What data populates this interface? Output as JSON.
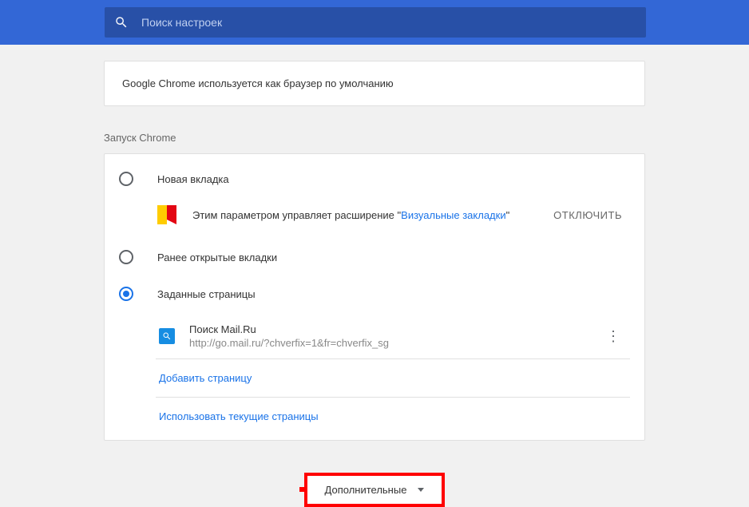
{
  "search": {
    "placeholder": "Поиск настроек"
  },
  "defaultBrowser": {
    "message": "Google Chrome используется как браузер по умолчанию"
  },
  "startup": {
    "sectionTitle": "Запуск Chrome",
    "options": {
      "newTab": "Новая вкладка",
      "continue": "Ранее открытые вкладки",
      "specific": "Заданные страницы"
    },
    "extension": {
      "prefix": "Этим параметром управляет расширение ",
      "name": "Визуальные закладки",
      "disable": "ОТКЛЮЧИТЬ"
    },
    "pages": [
      {
        "title": "Поиск Mail.Ru",
        "url": "http://go.mail.ru/?chverfix=1&fr=chverfix_sg"
      }
    ],
    "addPage": "Добавить страницу",
    "useCurrent": "Использовать текущие страницы"
  },
  "advanced": {
    "label": "Дополнительные"
  }
}
